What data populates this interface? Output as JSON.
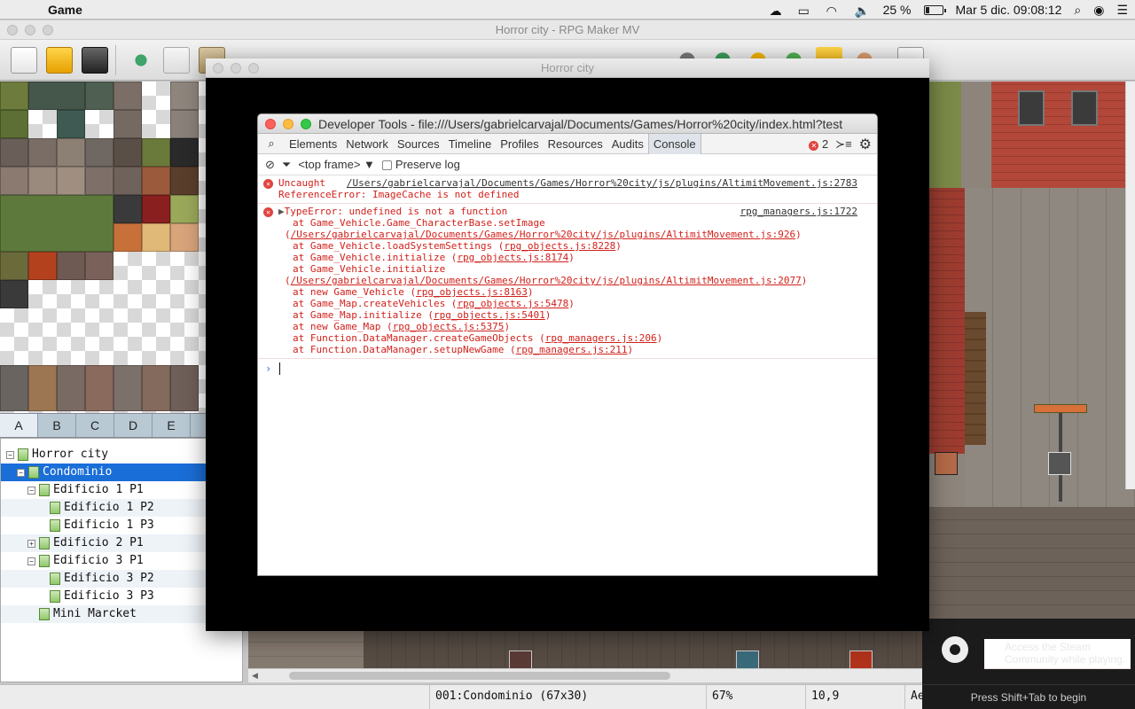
{
  "menubar": {
    "app_name": "Game",
    "battery_percent": "25 %",
    "battery_level": 0.25,
    "datetime": "Mar 5 dic.  09:08:12"
  },
  "rpg_window": {
    "title": "Horror city - RPG Maker MV"
  },
  "tileset_tabs": [
    "A",
    "B",
    "C",
    "D",
    "E"
  ],
  "map_tree": [
    {
      "label": "Horror city",
      "indent": 0,
      "expander": "−",
      "selected": false
    },
    {
      "label": "Condominio",
      "indent": 1,
      "expander": "−",
      "selected": true
    },
    {
      "label": "Edificio 1 P1",
      "indent": 2,
      "expander": "−",
      "selected": false
    },
    {
      "label": "Edificio 1 P2",
      "indent": 3,
      "expander": "",
      "selected": false
    },
    {
      "label": "Edificio 1 P3",
      "indent": 3,
      "expander": "",
      "selected": false
    },
    {
      "label": "Edificio 2 P1",
      "indent": 2,
      "expander": "+",
      "selected": false
    },
    {
      "label": "Edificio 3 P1",
      "indent": 2,
      "expander": "−",
      "selected": false
    },
    {
      "label": "Edificio 3 P2",
      "indent": 3,
      "expander": "",
      "selected": false
    },
    {
      "label": "Edificio 3 P3",
      "indent": 3,
      "expander": "",
      "selected": false
    },
    {
      "label": "Mini Marcket",
      "indent": 2,
      "expander": "",
      "selected": false
    }
  ],
  "game_window": {
    "title": "Horror city"
  },
  "devtools": {
    "title": "Developer Tools - file:///Users/gabrielcarvajal/Documents/Games/Horror%20city/index.html?test",
    "tabs": [
      "Elements",
      "Network",
      "Sources",
      "Timeline",
      "Profiles",
      "Resources",
      "Audits",
      "Console"
    ],
    "active_tab": "Console",
    "error_count": "2",
    "frame_select": "<top frame>",
    "preserve_log_label": "Preserve log",
    "messages": [
      {
        "prefix": "Uncaught",
        "source": "/Users/gabrielcarvajal/Documents/Games/Horror%20city/js/plugins/AltimitMovement.js:2783",
        "text": "ReferenceError: ImageCache is not defined"
      },
      {
        "text": "TypeError: undefined is not a function",
        "source": "rpg_managers.js:1722",
        "stack": [
          {
            "text": "at Game_Vehicle.Game_CharacterBase.setImage",
            "link": "",
            "deep": true
          },
          {
            "text": "(",
            "link": "/Users/gabrielcarvajal/Documents/Games/Horror%20city/js/plugins/AltimitMovement.js:926",
            "deep": false
          },
          {
            "text": "at Game_Vehicle.loadSystemSettings (",
            "link": "rpg_objects.js:8228",
            "deep": true
          },
          {
            "text": "at Game_Vehicle.initialize (",
            "link": "rpg_objects.js:8174",
            "deep": true
          },
          {
            "text": "at Game_Vehicle.initialize",
            "link": "",
            "deep": true
          },
          {
            "text": "(",
            "link": "/Users/gabrielcarvajal/Documents/Games/Horror%20city/js/plugins/AltimitMovement.js:2077",
            "deep": false
          },
          {
            "text": "at new Game_Vehicle (",
            "link": "rpg_objects.js:8163",
            "deep": true
          },
          {
            "text": "at Game_Map.createVehicles (",
            "link": "rpg_objects.js:5478",
            "deep": true
          },
          {
            "text": "at Game_Map.initialize (",
            "link": "rpg_objects.js:5401",
            "deep": true
          },
          {
            "text": "at new Game_Map (",
            "link": "rpg_objects.js:5375",
            "deep": true
          },
          {
            "text": "at Function.DataManager.createGameObjects (",
            "link": "rpg_managers.js:206",
            "deep": true
          },
          {
            "text": "at Function.DataManager.setupNewGame (",
            "link": "rpg_managers.js:211",
            "deep": true
          }
        ]
      }
    ],
    "prompt_symbol": "›"
  },
  "statusbar": {
    "map_info": "001:Condominio (67x30)",
    "zoom": "67%",
    "coords": "10,9",
    "extra": "Ae"
  },
  "steam": {
    "message": "Access the Steam Community while playing.",
    "hint": "Press Shift+Tab to begin"
  },
  "colors": {
    "error_red": "#d1211b",
    "selection_blue": "#1a6ed8",
    "console_link": "#333333"
  }
}
